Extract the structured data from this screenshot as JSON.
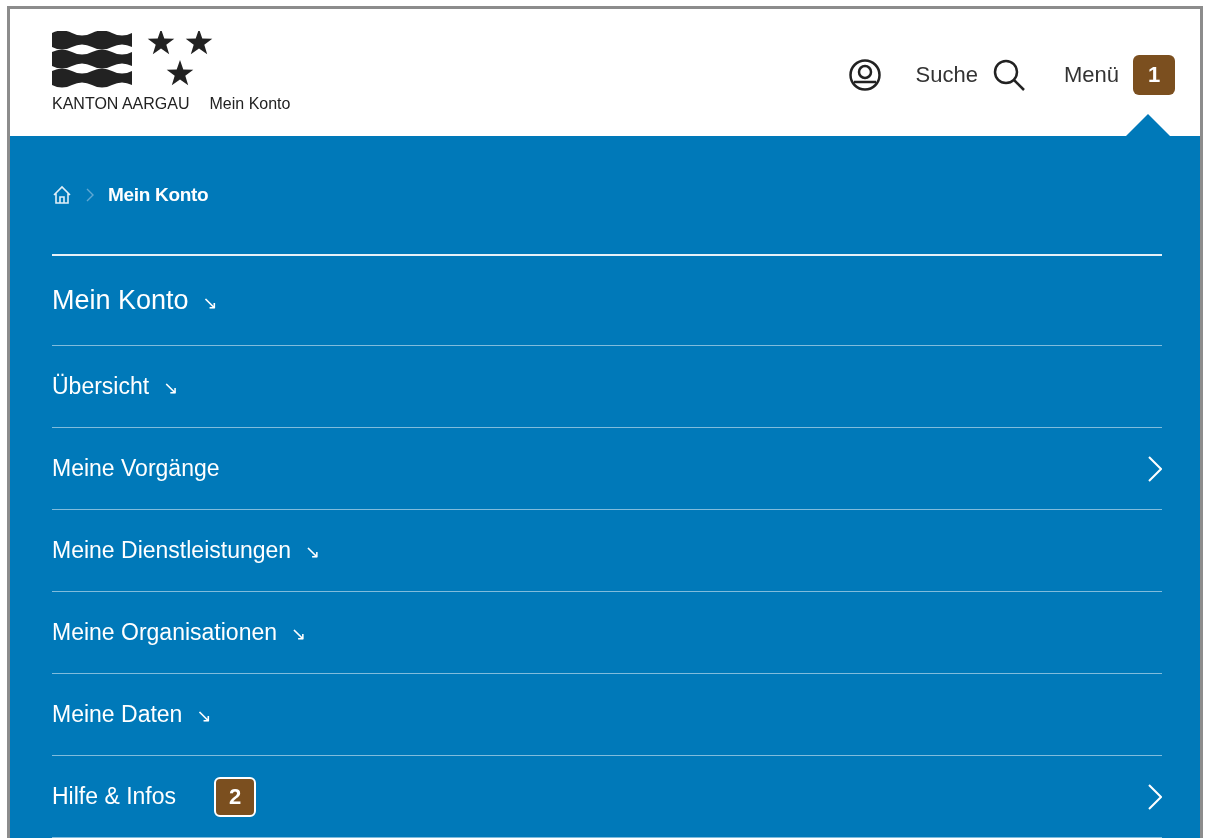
{
  "header": {
    "brand": "KANTON AARGAU",
    "site": "Mein Konto",
    "search_label": "Suche",
    "menu_label": "Menü",
    "menu_badge": "1",
    "menu_expanded": true
  },
  "breadcrumb": {
    "current": "Mein Konto"
  },
  "menu_items": [
    {
      "label": "Mein Konto",
      "kind": "heading",
      "suffix": "↘"
    },
    {
      "label": "Übersicht",
      "kind": "arrow",
      "suffix": "↘"
    },
    {
      "label": "Meine Vorgänge",
      "kind": "chevron"
    },
    {
      "label": "Meine Dienstleistungen",
      "kind": "arrow",
      "suffix": "↘"
    },
    {
      "label": "Meine Organisationen",
      "kind": "arrow",
      "suffix": "↘"
    },
    {
      "label": "Meine Daten",
      "kind": "arrow",
      "suffix": "↘"
    },
    {
      "label": "Hilfe & Infos",
      "kind": "chevron",
      "badge": "2"
    }
  ]
}
